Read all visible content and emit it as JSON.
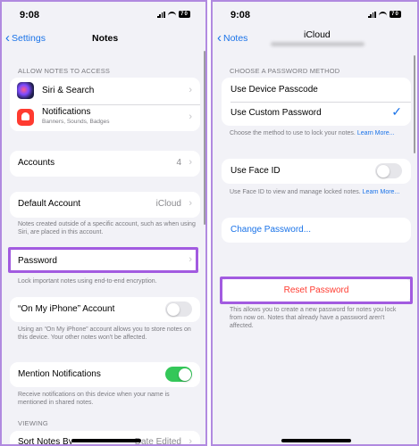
{
  "left": {
    "status_time": "9:08",
    "battery": "70",
    "back_label": "Settings",
    "title": "Notes",
    "allow_header": "ALLOW NOTES TO ACCESS",
    "siri_label": "Siri & Search",
    "notifications_label": "Notifications",
    "notifications_sub": "Banners, Sounds, Badges",
    "accounts_label": "Accounts",
    "accounts_value": "4",
    "default_account_label": "Default Account",
    "default_account_value": "iCloud",
    "default_account_footer": "Notes created outside of a specific account, such as when using Siri, are placed in this account.",
    "password_label": "Password",
    "password_footer": "Lock important notes using end-to-end encryption.",
    "on_my_iphone_label": "“On My iPhone” Account",
    "on_my_iphone_toggle": false,
    "on_my_iphone_footer": "Using an “On My iPhone” account allows you to store notes on this device. Your other notes won't be affected.",
    "mention_label": "Mention Notifications",
    "mention_toggle": true,
    "mention_footer": "Receive notifications on this device when your name is mentioned in shared notes.",
    "viewing_header": "VIEWING",
    "sort_label": "Sort Notes By",
    "sort_value": "Date Edited"
  },
  "right": {
    "status_time": "9:08",
    "battery": "70",
    "back_label": "Notes",
    "title": "iCloud",
    "method_header": "CHOOSE A PASSWORD METHOD",
    "device_passcode_label": "Use Device Passcode",
    "custom_password_label": "Use Custom Password",
    "method_footer": "Choose the method to use to lock your notes.",
    "method_footer_link": "Learn More...",
    "face_id_label": "Use Face ID",
    "face_id_toggle": false,
    "face_id_footer": "Use Face ID to view and manage locked notes.",
    "face_id_footer_link": "Learn More...",
    "change_password_label": "Change Password...",
    "reset_password_label": "Reset Password",
    "reset_footer": "This allows you to create a new password for notes you lock from now on. Notes that already have a password aren't affected."
  },
  "colors": {
    "accent_blue": "#1a73e8",
    "toggle_on": "#34c759",
    "destructive_red": "#ff3b30",
    "highlight_purple": "#a25be0",
    "panel_border": "#b18ae0"
  },
  "icons": [
    "siri-icon",
    "notifications-icon",
    "chevron-right-icon",
    "checkmark-icon",
    "wifi-icon",
    "signal-icon",
    "battery-icon"
  ]
}
